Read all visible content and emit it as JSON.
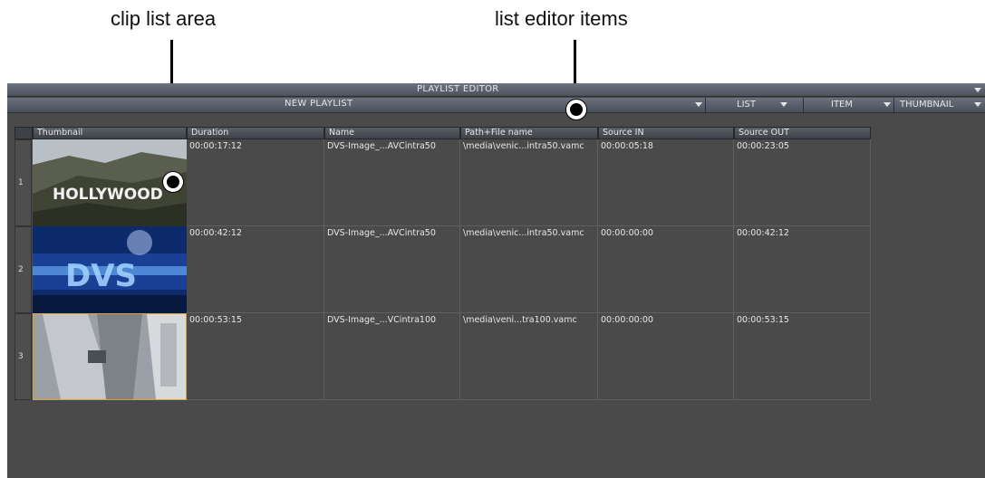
{
  "callouts": {
    "left": "clip list area",
    "right": "list editor items"
  },
  "window": {
    "title": "PLAYLIST EDITOR",
    "playlist_name": "NEW PLAYLIST",
    "menus": [
      "LIST",
      "ITEM",
      "THUMBNAIL"
    ]
  },
  "table": {
    "columns": [
      "Thumbnail",
      "Duration",
      "Name",
      "Path+File name",
      "Source IN",
      "Source OUT"
    ],
    "rows": [
      {
        "num": "1",
        "thumbnail": "hollywood-sign",
        "duration": "00:00:17:12",
        "name": "DVS-Image_...AVCintra50",
        "path": "\\media\\venic...intra50.vamc",
        "source_in": "00:00:05:18",
        "source_out": "00:00:23:05"
      },
      {
        "num": "2",
        "thumbnail": "dvs-logo-blue",
        "duration": "00:00:42:12",
        "name": "DVS-Image_...AVCintra50",
        "path": "\\media\\venic...intra50.vamc",
        "source_in": "00:00:00:00",
        "source_out": "00:00:42:12"
      },
      {
        "num": "3",
        "thumbnail": "building-facade",
        "duration": "00:00:53:15",
        "name": "DVS-Image_...VCintra100",
        "path": "\\media\\veni...tra100.vamc",
        "source_in": "00:00:00:00",
        "source_out": "00:00:53:15"
      }
    ]
  },
  "colors": {
    "background": "#4a4a4a",
    "selected_row_border": "#d9a13a"
  }
}
